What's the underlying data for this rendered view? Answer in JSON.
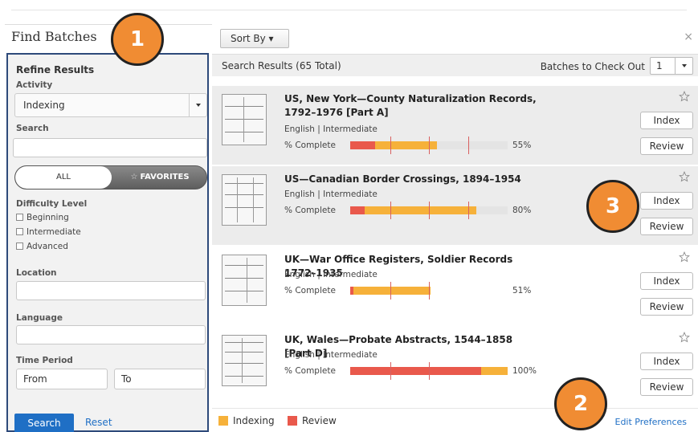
{
  "header": {
    "title": "Find Batches",
    "close": "×"
  },
  "sidebar": {
    "heading": "Refine Results",
    "activity_label": "Activity",
    "activity_value": "Indexing",
    "search_label": "Search",
    "search_value": "",
    "toggle": {
      "all": "ALL",
      "favorites": "FAVORITES"
    },
    "difficulty_label": "Difficulty Level",
    "difficulty_options": [
      "Beginning",
      "Intermediate",
      "Advanced"
    ],
    "location_label": "Location",
    "language_label": "Language",
    "time_period_label": "Time Period",
    "from_placeholder": "From",
    "to_placeholder": "To",
    "search_button": "Search",
    "reset_link": "Reset"
  },
  "main": {
    "sort_by": "Sort By ▾",
    "results_count": "Search Results (65 Total)",
    "checkout_label": "Batches to Check Out",
    "checkout_value": "1",
    "percent_label": "% Complete",
    "index_button": "Index",
    "review_button": "Review",
    "batches": [
      {
        "title": "US, New York—County Naturalization Records, 1792–1976 [Part A]",
        "meta": "English | Intermediate",
        "percent": "55%",
        "review_fraction": 0.16,
        "indexing_fraction": 0.39
      },
      {
        "title": "US—Canadian Border Crossings, 1894–1954",
        "meta": "English | Intermediate",
        "percent": "80%",
        "review_fraction": 0.09,
        "indexing_fraction": 0.71
      },
      {
        "title": "UK—War Office Registers, Soldier Records 1772–1935",
        "meta": "English | Intermediate",
        "percent": "51%",
        "review_fraction": 0.02,
        "indexing_fraction": 0.49
      },
      {
        "title": "UK, Wales—Probate Abstracts, 1544–1858 [Part D]",
        "meta": "English | Intermediate",
        "percent": "100%",
        "review_fraction": 0.83,
        "indexing_fraction": 0.17
      }
    ]
  },
  "legend": {
    "indexing": "Indexing",
    "review": "Review",
    "edit_preferences": "Edit Preferences"
  },
  "badges": [
    "1",
    "2",
    "3"
  ],
  "colors": {
    "indexing": "#f6b13a",
    "review": "#e9594c",
    "accent": "#1f6fc5",
    "badge": "#f08c33"
  }
}
